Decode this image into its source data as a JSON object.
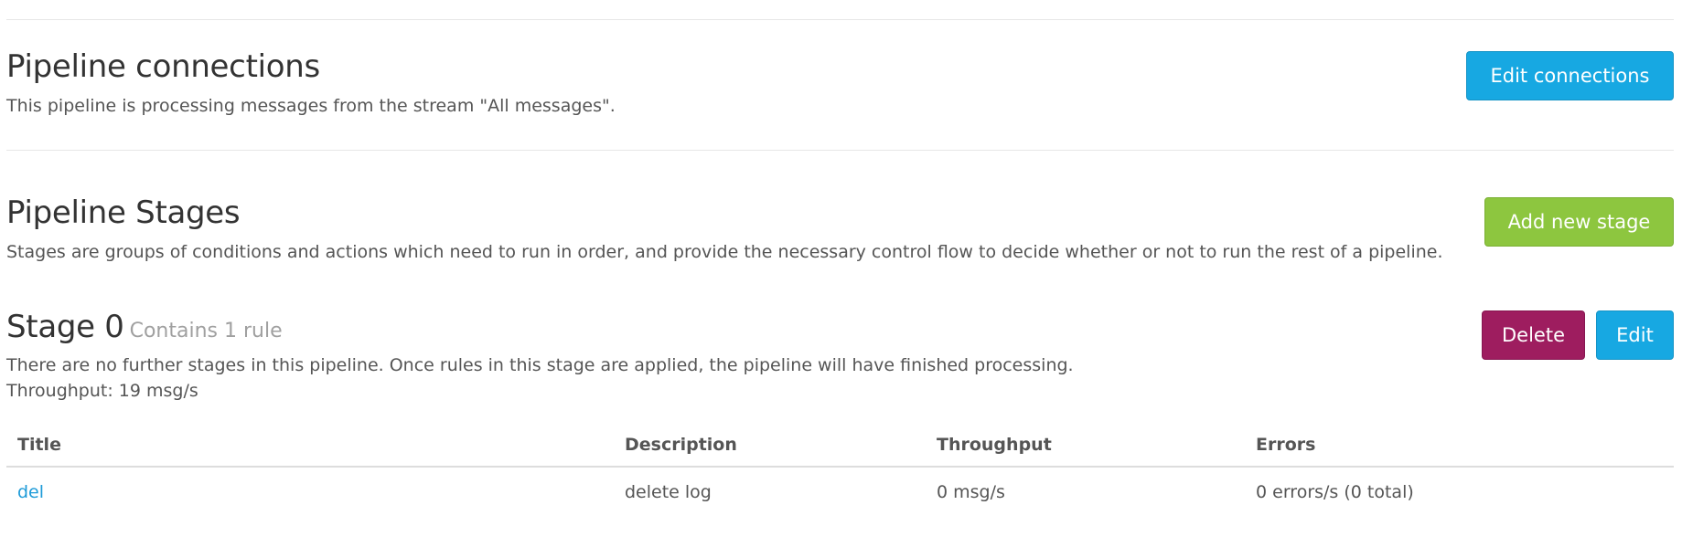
{
  "connections": {
    "title": "Pipeline connections",
    "description": "This pipeline is processing messages from the stream \"All messages\".",
    "edit_button": "Edit connections"
  },
  "stages_section": {
    "title": "Pipeline Stages",
    "description": "Stages are groups of conditions and actions which need to run in order, and provide the necessary control flow to decide whether or not to run the rest of a pipeline.",
    "add_button": "Add new stage"
  },
  "stage": {
    "title": "Stage 0",
    "subtitle": "Contains 1 rule",
    "description": "There are no further stages in this pipeline. Once rules in this stage are applied, the pipeline will have finished processing.",
    "throughput": "Throughput: 19 msg/s",
    "delete_button": "Delete",
    "edit_button": "Edit"
  },
  "table": {
    "headers": [
      "Title",
      "Description",
      "Throughput",
      "Errors"
    ],
    "rows": [
      [
        "del",
        "delete log",
        "0 msg/s",
        "0 errors/s (0 total)"
      ]
    ]
  },
  "colors": {
    "info": "#17a8e2",
    "success": "#8dc63f",
    "danger": "#9e1d5f",
    "link": "#1e9bd8"
  }
}
